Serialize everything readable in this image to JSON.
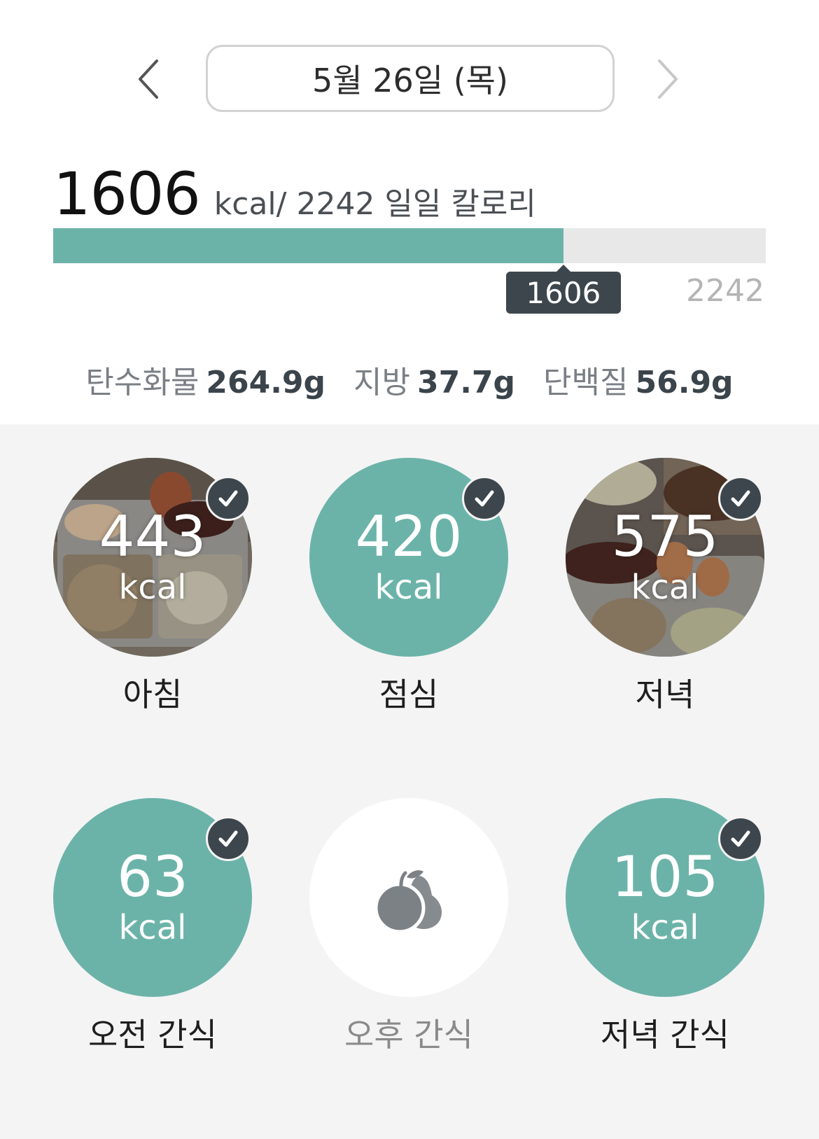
{
  "header": {
    "date": "5월 26일 (목)",
    "prev_icon": "chevron-left-icon",
    "next_icon": "chevron-right-icon"
  },
  "calories": {
    "consumed": "1606",
    "suffix": "kcal/ 2242 일일 칼로리",
    "goal": "2242",
    "progress_fraction": 0.716,
    "fill_color": "#6bb3a9"
  },
  "macros": [
    {
      "name": "탄수화물",
      "value": "264.9g"
    },
    {
      "name": "지방",
      "value": "37.7g"
    },
    {
      "name": "단백질",
      "value": "56.9g"
    }
  ],
  "meals": [
    {
      "label": "아침",
      "kcal": "443",
      "unit": "kcal",
      "checked": true,
      "style": "photo"
    },
    {
      "label": "점심",
      "kcal": "420",
      "unit": "kcal",
      "checked": true,
      "style": "teal"
    },
    {
      "label": "저녁",
      "kcal": "575",
      "unit": "kcal",
      "checked": true,
      "style": "photo"
    },
    {
      "label": "오전 간식",
      "kcal": "63",
      "unit": "kcal",
      "checked": true,
      "style": "teal"
    },
    {
      "label": "오후 간식",
      "icon": "fruit-icon",
      "checked": false,
      "style": "empty"
    },
    {
      "label": "저녁 간식",
      "kcal": "105",
      "unit": "kcal",
      "checked": true,
      "style": "teal"
    }
  ],
  "colors": {
    "accent": "#6bb3a9",
    "badge": "#3d464d"
  }
}
